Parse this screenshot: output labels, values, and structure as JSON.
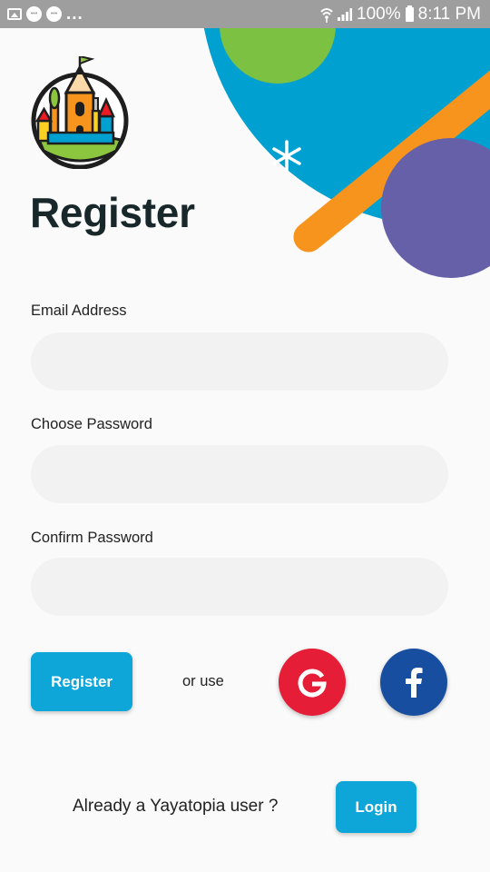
{
  "status_bar": {
    "left_icons": [
      "gallery-icon",
      "notification-icon",
      "notification-icon"
    ],
    "overflow": "...",
    "battery": "100%",
    "time": "8:11 PM"
  },
  "logo": {
    "icon": "castle-pencil-logo"
  },
  "page": {
    "title": "Register"
  },
  "form": {
    "email": {
      "label": "Email Address",
      "value": "",
      "placeholder": ""
    },
    "password": {
      "label": "Choose Password",
      "value": "",
      "placeholder": ""
    },
    "confirm": {
      "label": "Confirm Password",
      "value": "",
      "placeholder": ""
    }
  },
  "actions": {
    "register_label": "Register",
    "or_use": "or use",
    "google_letter": "G",
    "facebook_letter": "f"
  },
  "footer": {
    "prompt": "Already a Yayatopia user ?",
    "login_label": "Login"
  },
  "colors": {
    "accent_blue": "#0ea5d8",
    "google_red": "#e51d36",
    "facebook_blue": "#174ea0",
    "deco_green": "#7cc142",
    "deco_orange": "#f7941d",
    "deco_purple": "#6560a8"
  }
}
